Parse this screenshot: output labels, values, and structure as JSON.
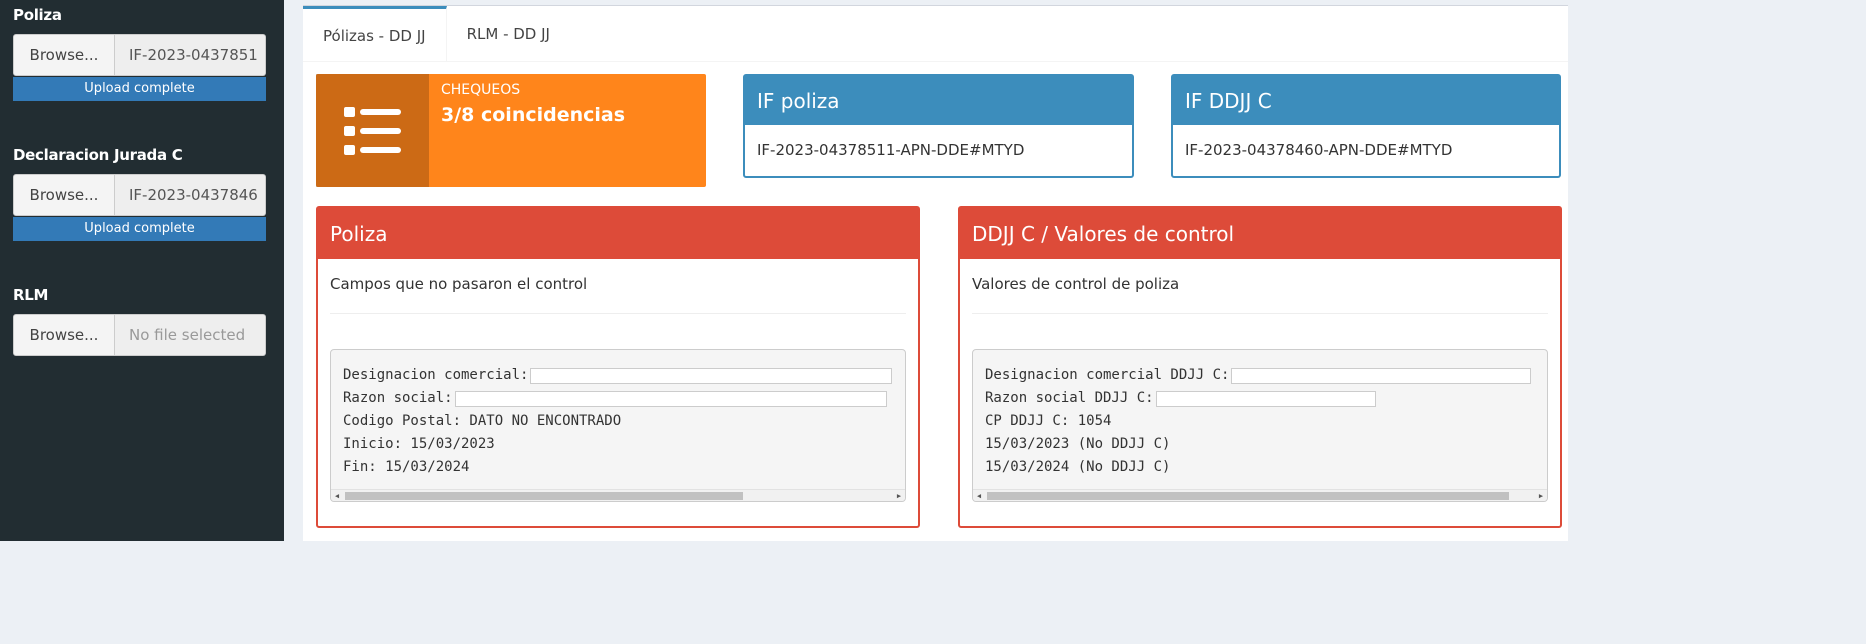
{
  "sidebar": {
    "poliza": {
      "label": "Poliza",
      "browse": "Browse...",
      "file": "IF-2023-0437851",
      "status": "Upload complete"
    },
    "ddjj": {
      "label": "Declaracion Jurada C",
      "browse": "Browse...",
      "file": "IF-2023-0437846",
      "status": "Upload complete"
    },
    "rlm": {
      "label": "RLM",
      "browse": "Browse...",
      "placeholder": "No file selected"
    }
  },
  "tabs": [
    {
      "label": "Pólizas - DD JJ",
      "active": true
    },
    {
      "label": "RLM - DD JJ",
      "active": false
    }
  ],
  "info_box": {
    "icon": "list-icon",
    "title": "CHEQUEOS",
    "value": "3/8 coincidencias",
    "color": "#ff851b"
  },
  "if_poliza": {
    "title": "IF poliza",
    "value": "IF-2023-04378511-APN-DDE#MTYD"
  },
  "if_ddjj": {
    "title": "IF DDJJ C",
    "value": "IF-2023-04378460-APN-DDE#MTYD"
  },
  "poliza_box": {
    "title": "Poliza",
    "subtitle": "Campos que no pasaron el control",
    "lines": [
      "Designacion comercial:",
      "Razon social:",
      "Codigo Postal: DATO NO ENCONTRADO",
      "Inicio: 15/03/2023",
      "Fin: 15/03/2024"
    ]
  },
  "ddjj_box": {
    "title": "DDJJ C / Valores de control",
    "subtitle": "Valores de control de poliza",
    "lines": [
      "Designacion comercial DDJJ C:",
      "Razon social DDJJ C:",
      "CP DDJJ C: 1054",
      "15/03/2023 (No DDJJ C)",
      "15/03/2024 (No DDJJ C)"
    ]
  },
  "colors": {
    "primary": "#3c8dbc",
    "danger": "#dd4b39",
    "warning": "#ff851b",
    "sidebar": "#222d32",
    "upload": "#337ab7"
  }
}
